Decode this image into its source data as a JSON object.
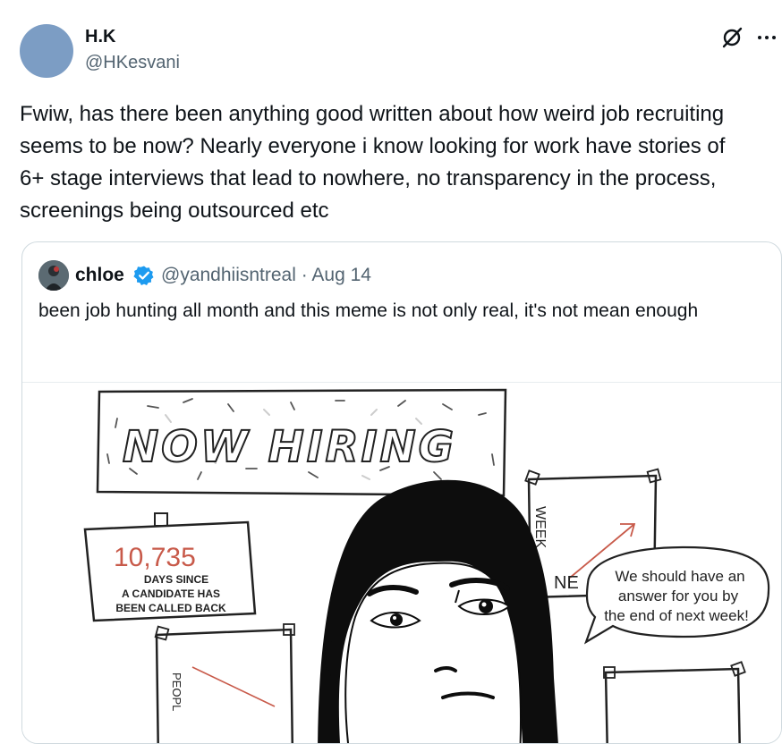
{
  "tweet": {
    "author_name": "H.K",
    "author_handle": "@HKesvani",
    "text": "Fwiw, has there been anything good written about how weird job recruiting seems to be now? Nearly everyone i know looking for work have stories of 6+ stage interviews that lead to nowhere, no transparency in the process, screenings being outsourced etc",
    "avatar_color": "#7c9dc4",
    "icons": [
      "grok-icon",
      "more-icon"
    ]
  },
  "quote": {
    "author_name": "chloe",
    "author_handle_date": "@yandhiisntreal · Aug 14",
    "verified": true,
    "verified_color": "#1d9bf0",
    "text": "been job hunting all month and this meme is not only real, it's not mean enough"
  },
  "meme": {
    "banner": "NOW HIRING",
    "counter_number": "10,735",
    "counter_caption_1": "DAYS SINCE",
    "counter_caption_2": "A CANDIDATE HAS",
    "counter_caption_3": "BEEN CALLED BACK",
    "chart_label_week": "WEEK",
    "chart_label_ne": "NE",
    "chart_label_people": "PEOPL",
    "speech_line_1": "We should have an",
    "speech_line_2": "answer for you by",
    "speech_line_3": "the end of next week!"
  }
}
